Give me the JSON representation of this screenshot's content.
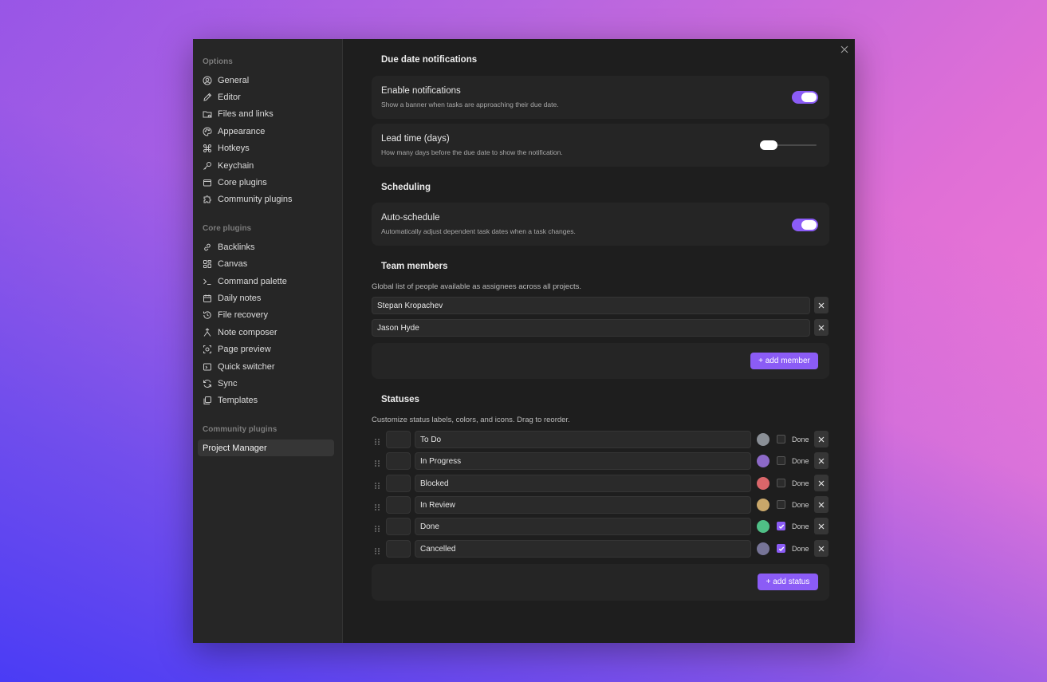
{
  "sidebar": {
    "sections": [
      {
        "heading": "Options",
        "items": [
          {
            "label": "General",
            "icon": "user-circle-icon"
          },
          {
            "label": "Editor",
            "icon": "pencil-icon"
          },
          {
            "label": "Files and links",
            "icon": "folder-icon"
          },
          {
            "label": "Appearance",
            "icon": "palette-icon"
          },
          {
            "label": "Hotkeys",
            "icon": "command-icon"
          },
          {
            "label": "Keychain",
            "icon": "key-icon"
          },
          {
            "label": "Core plugins",
            "icon": "plug-icon"
          },
          {
            "label": "Community plugins",
            "icon": "puzzle-icon"
          }
        ]
      },
      {
        "heading": "Core plugins",
        "items": [
          {
            "label": "Backlinks",
            "icon": "link-icon"
          },
          {
            "label": "Canvas",
            "icon": "grid-icon"
          },
          {
            "label": "Command palette",
            "icon": "terminal-icon"
          },
          {
            "label": "Daily notes",
            "icon": "calendar-icon"
          },
          {
            "label": "File recovery",
            "icon": "history-icon"
          },
          {
            "label": "Note composer",
            "icon": "merge-icon"
          },
          {
            "label": "Page preview",
            "icon": "preview-icon"
          },
          {
            "label": "Quick switcher",
            "icon": "switcher-icon"
          },
          {
            "label": "Sync",
            "icon": "sync-icon"
          },
          {
            "label": "Templates",
            "icon": "template-icon"
          }
        ]
      },
      {
        "heading": "Community plugins",
        "items": [
          {
            "label": "Project Manager",
            "icon": "",
            "active": true
          }
        ]
      }
    ]
  },
  "notifications": {
    "title": "Due date notifications",
    "enable": {
      "title": "Enable notifications",
      "desc": "Show a banner when tasks are approaching their due date.",
      "on": true
    },
    "lead": {
      "title": "Lead time (days)",
      "desc": "How many days before the due date to show the notification.",
      "value_fraction": 0.0
    }
  },
  "scheduling": {
    "title": "Scheduling",
    "auto": {
      "title": "Auto-schedule",
      "desc": "Automatically adjust dependent task dates when a task changes.",
      "on": true
    }
  },
  "team": {
    "title": "Team members",
    "desc": "Global list of people available as assignees across all projects.",
    "members": [
      "Stepan Kropachev",
      "Jason Hyde"
    ],
    "add_label": "+ add member"
  },
  "statuses": {
    "title": "Statuses",
    "desc": "Customize status labels, colors, and icons. Drag to reorder.",
    "done_label": "Done",
    "items": [
      {
        "label": "To Do",
        "color": "#8a8f96",
        "done": false
      },
      {
        "label": "In Progress",
        "color": "#8c69c7",
        "done": false
      },
      {
        "label": "Blocked",
        "color": "#d9666a",
        "done": false
      },
      {
        "label": "In Review",
        "color": "#c9a76a",
        "done": false
      },
      {
        "label": "Done",
        "color": "#4fbf86",
        "done": true
      },
      {
        "label": "Cancelled",
        "color": "#767497",
        "done": true
      }
    ],
    "add_label": "+ add status"
  },
  "colors": {
    "accent": "#8b5cf6",
    "modal_bg": "#1e1e1e",
    "sidebar_bg": "#262626"
  }
}
